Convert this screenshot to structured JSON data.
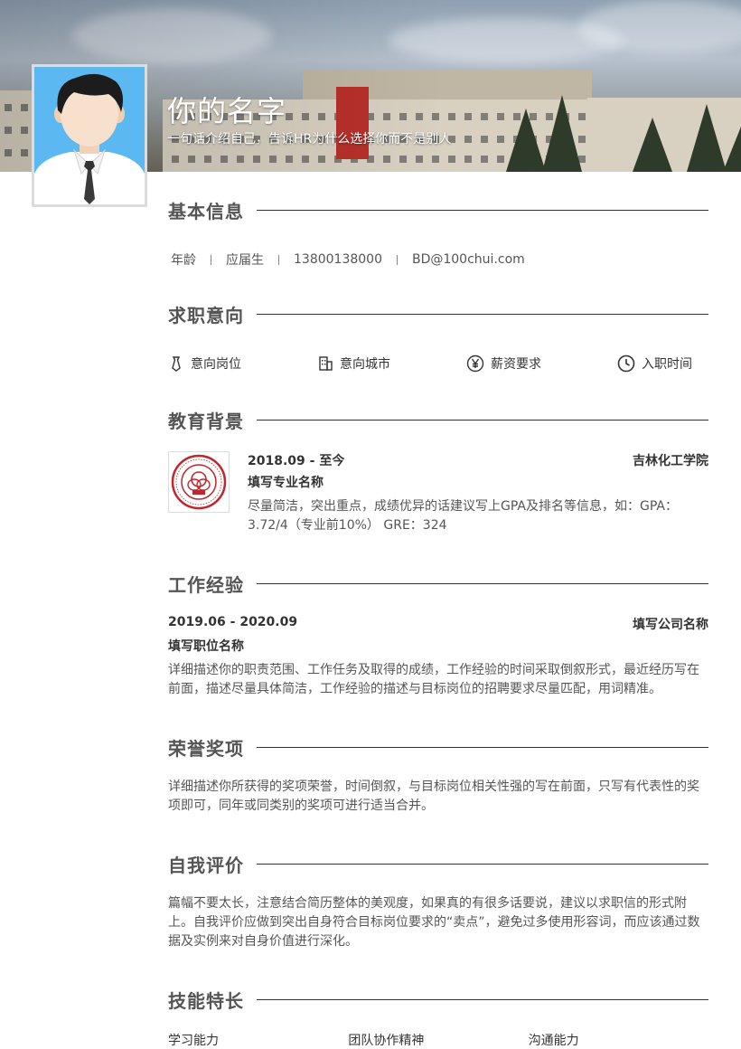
{
  "header": {
    "name": "你的名字",
    "tagline": "一句话介绍自己，告诉HR为什么选择你而不是别人"
  },
  "basic_info": {
    "title": "基本信息",
    "items": [
      "年龄",
      "应届生",
      "13800138000",
      "BD@100chui.com"
    ]
  },
  "job_intent": {
    "title": "求职意向",
    "items": [
      {
        "icon": "tie-icon",
        "label": "意向岗位"
      },
      {
        "icon": "building-icon",
        "label": "意向城市"
      },
      {
        "icon": "yen-icon",
        "label": "薪资要求"
      },
      {
        "icon": "clock-icon",
        "label": "入职时间"
      }
    ]
  },
  "education": {
    "title": "教育背景",
    "period": "2018.09 - 至今",
    "school": "吉林化工学院",
    "major": "填写专业名称",
    "description": "尽量简洁，突出重点，成绩优异的话建议写上GPA及排名等信息，如：GPA：3.72/4（专业前10%） GRE：324"
  },
  "work": {
    "title": "工作经验",
    "period": "2019.06 - 2020.09",
    "company": "填写公司名称",
    "position": "填写职位名称",
    "description": "详细描述你的职责范围、工作任务及取得的成绩，工作经验的时间采取倒叙形式，最近经历写在前面，描述尽量具体简洁，工作经验的描述与目标岗位的招聘要求尽量匹配，用词精准。"
  },
  "honors": {
    "title": "荣誉奖项",
    "description": "详细描述你所获得的奖项荣誉，时间倒叙，与目标岗位相关性强的写在前面，只写有代表性的奖项即可，同年或同类别的奖项可进行适当合并。"
  },
  "self_eval": {
    "title": "自我评价",
    "description": "篇幅不要太长，注意结合简历整体的美观度，如果真的有很多话要说，建议以求职信的形式附上。自我评价应做到突出自身符合目标岗位要求的“卖点”，避免过多使用形容词，而应该通过数据及实例来对自身价值进行深化。"
  },
  "skills": {
    "title": "技能特长",
    "items": [
      "学习能力",
      "团队协作精神",
      "沟通能力"
    ]
  },
  "colors": {
    "accent": "#555555",
    "avatar_bg": "#5bb8f0",
    "logo_red": "#c0262d"
  }
}
